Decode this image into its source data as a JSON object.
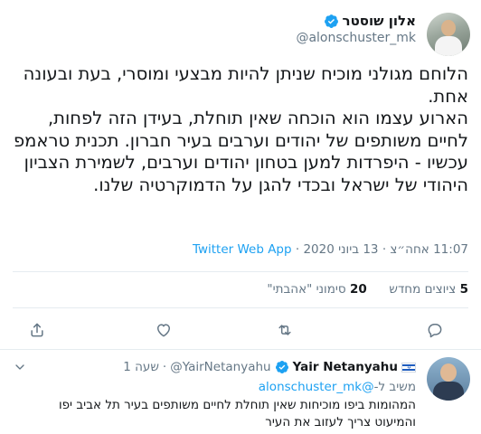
{
  "tweet": {
    "display_name": "אלון שוסטר",
    "handle": "@alonschuster_mk",
    "text": "הלוחם מגולני מוכיח שניתן להיות מבצעי ומוסרי, בעת ובעונה אחת.\nהארוע עצמו הוא הוכחה שאין תוחלת, בעידן הזה לפחות, לחיים משותפים של יהודים וערבים בעיר חברון. תכנית טראמפ עכשיו - היפרדות למען בטחון יהודים וערבים, לשמירת הצביון היהודי של ישראל ובכדי להגן על הדמוקרטיה שלנו.",
    "time": "11:07 אחה״צ",
    "date": "13 ביוני 2020",
    "separator": "·",
    "source": "Twitter Web App"
  },
  "stats": {
    "retweets_count": "5",
    "retweets_label": "ציוצים מחדש",
    "likes_count": "20",
    "likes_label": "סימוני \"אהבתי\""
  },
  "actions": {
    "icons": [
      "reply-icon",
      "retweet-icon",
      "like-icon",
      "share-icon"
    ]
  },
  "reply": {
    "name": "Yair Netanyahu",
    "handle": "@YairNetanyahu",
    "separator": "·",
    "time": "שעה 1",
    "replying_label": "משיב ל-",
    "replying_to": "@alonschuster_mk",
    "text": "המהומות ביפו מוכיחות שאין תוחלת לחיים משותפים בעיר תל אביב יפו\nוהמיעוט צריך לעזוב את העיר",
    "flag_glyph": "✡"
  },
  "colors": {
    "accent": "#1da1f2",
    "secondary_text": "#657786",
    "divider": "#e6ecf0"
  }
}
